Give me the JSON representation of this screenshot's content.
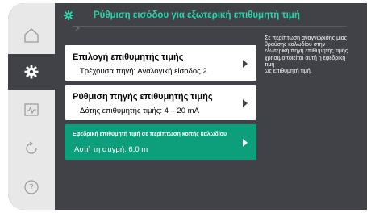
{
  "header": {
    "title": "Ρύθμιση εισόδου για εξωτερική επιθυμητή τιμή",
    "icon": "gear-icon",
    "accent_color": "#2bd3a8"
  },
  "sidebar": {
    "items": [
      {
        "name": "home",
        "icon": "home-icon",
        "active": false
      },
      {
        "name": "settings",
        "icon": "gear-icon",
        "active": true
      },
      {
        "name": "diagnostics",
        "icon": "diagnostics-icon",
        "active": false
      },
      {
        "name": "restore",
        "icon": "restore-icon",
        "active": false
      },
      {
        "name": "help",
        "icon": "help-icon",
        "active": false
      }
    ]
  },
  "menu": {
    "items": [
      {
        "label": "Επιλογή επιθυμητής τιμής",
        "value": "Τρέχουσα πηγή: Αναλογική είσοδος 2",
        "selected": false
      },
      {
        "label": "Ρύθμιση πηγής επιθυμητής τιμής",
        "value": "Δότης επιθυμητής τιμής: 4 – 20 mA",
        "selected": false
      },
      {
        "label": "Εφεδρική επιθυμητή τιμή σε περίπτωση κοπής καλωδίου",
        "value": "Αυτή τη στιγμή: 6,0 m",
        "selected": true
      }
    ],
    "selected_color": "#0d9f7b"
  },
  "help_text": {
    "lines": [
      "Σε περίπτωση αναγνώρισης μιας",
      "θραύσης καλωδίου στην",
      "εξωτερική πηγή επιθυμητής τιμής",
      "χρησιμοποιείται αυτή η εφεδρική",
      "τιμή",
      "ως επιθυμητή τιμή."
    ]
  }
}
